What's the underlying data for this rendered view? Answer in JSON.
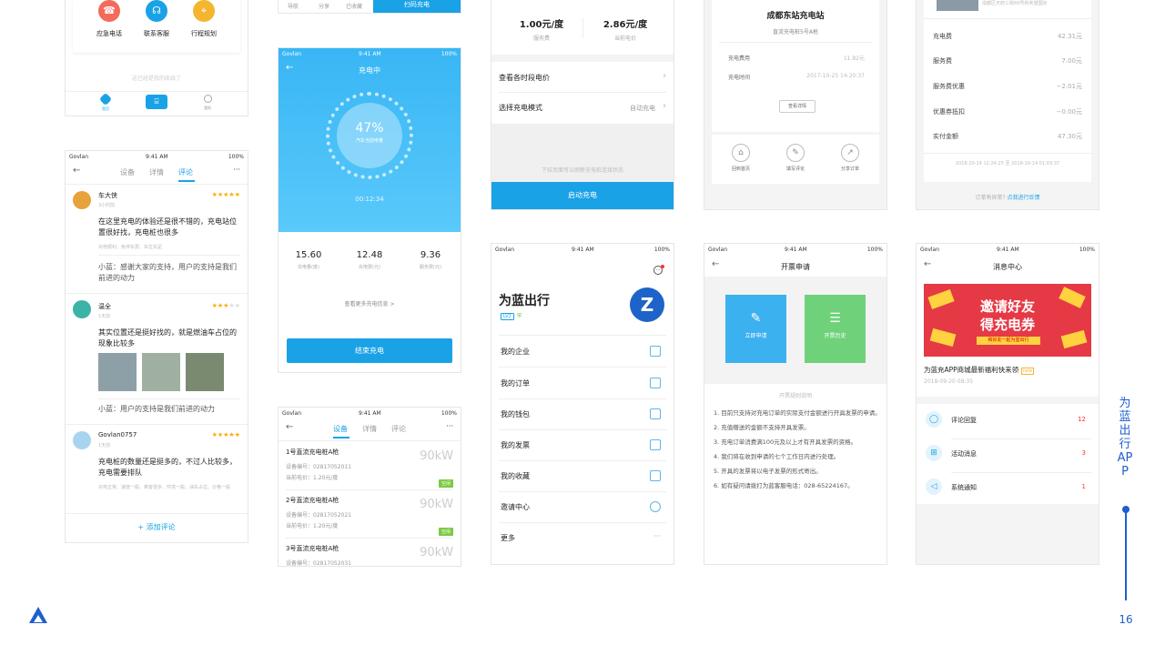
{
  "s1": {
    "actions": [
      {
        "label": "应急电话",
        "color": "#f26b5b"
      },
      {
        "label": "联系客服",
        "color": "#1aa2e6"
      },
      {
        "label": "行程规划",
        "color": "#f5b52e"
      }
    ],
    "bottom_note": "这已经是我的底线了",
    "tabbar": [
      {
        "label": "首页"
      },
      {
        "label": ""
      },
      {
        "label": "我的"
      }
    ]
  },
  "s2": {
    "tabs": [
      "导航",
      "分享",
      "已收藏"
    ],
    "button": "扫码充电"
  },
  "s3": {
    "prices": [
      {
        "value": "1.00元/度",
        "label": "服务费"
      },
      {
        "value": "2.86元/度",
        "label": "当前电价"
      }
    ],
    "rows": [
      {
        "label": "查看各时段电价",
        "value": ""
      },
      {
        "label": "选择充电模式",
        "value": "自动充电"
      }
    ],
    "hint": "下拉页面可以刷新充电桩连接状态",
    "button": "启动充电"
  },
  "s4": {
    "station": "成都东站充电站",
    "pile": "直流充电桩5号A枪",
    "rows": [
      {
        "label": "充电费用",
        "value": "11.82元"
      },
      {
        "label": "充电时间",
        "value": "2017-10-25 14:20:37"
      }
    ],
    "detail_btn": "查看详情",
    "actions": [
      {
        "label": "回到首页"
      },
      {
        "label": "填写评论"
      },
      {
        "label": "分享订单"
      }
    ]
  },
  "s5": {
    "addr": "成都区天府三街69号新希望国际",
    "rows": [
      {
        "label": "充电费",
        "value": "42.31元"
      },
      {
        "label": "服务费",
        "value": "7.00元"
      },
      {
        "label": "服务费优惠",
        "value": "−2.01元"
      },
      {
        "label": "优惠券抵扣",
        "value": "−0.00元"
      },
      {
        "label": "实付金额",
        "value": "47.30元"
      }
    ],
    "times": "2018-10-14 12:24:25   至 2018-10-14 01:03:37",
    "footer_q": "订单有异常?",
    "footer_link": "点我进行反馈"
  },
  "status": {
    "carrier": "Govlan",
    "time": "9:41 AM",
    "battery": "100%"
  },
  "reviews": {
    "tabs": [
      "设备",
      "详情",
      "评论"
    ],
    "more": "···",
    "items": [
      {
        "name": "车大侠",
        "time": "3小时前",
        "stars": 5,
        "text": "在这里充电的体验还是很不错的，充电站位置很好找，充电桩也很多",
        "tags": "充电顺利、免停车费、车位充足",
        "reply": "小蓝：感谢大家的支持，用户的支持是我们前进的动力",
        "photos": 0
      },
      {
        "name": "温全",
        "time": "1天前",
        "stars": 3,
        "text": "其实位置还是挺好找的，就是燃油车占位的现象比较多",
        "tags": "",
        "reply": "小蓝：用户的支持是我们前进的动力",
        "photos": 3
      },
      {
        "name": "Govlan0757",
        "time": "1天前",
        "stars": 5,
        "text": "充电桩的数量还是挺多的，不过人比较多，充电需要排队",
        "tags": "充电正常、速度一般、乘客很多、环境一般、油车占位、价格一般",
        "reply": "",
        "photos": 0
      }
    ],
    "add": "+ 添加评论"
  },
  "charging": {
    "title": "充电中",
    "percent": "47%",
    "sub": "汽车当前电量",
    "timer": "00:12:34",
    "stats": [
      {
        "value": "15.60",
        "label": "充电量(度)"
      },
      {
        "value": "12.48",
        "label": "充电费(元)"
      },
      {
        "value": "9.36",
        "label": "服务费(元)"
      }
    ],
    "more": "查看更多充电信息 >",
    "button": "结束充电"
  },
  "devices": {
    "tabs": [
      "设备",
      "详情",
      "评论"
    ],
    "more": "···",
    "items": [
      {
        "name": "1号直流充电桩A枪",
        "code": "设备编号：02817052011",
        "price": "当前电价：1.20元/度",
        "power": "90kW",
        "state": "空闲"
      },
      {
        "name": "2号直流充电桩A枪",
        "code": "设备编号：02817052021",
        "price": "当前电价：1.20元/度",
        "power": "90kW",
        "state": "空闲"
      },
      {
        "name": "3号直流充电桩A枪",
        "code": "设备编号：02817052031",
        "price": "",
        "power": "90kW",
        "state": ""
      }
    ]
  },
  "mine": {
    "title": "为蓝出行",
    "level": "LV2",
    "menu": [
      {
        "label": "我的企业"
      },
      {
        "label": "我的订单"
      },
      {
        "label": "我的钱包"
      },
      {
        "label": "我的发票"
      },
      {
        "label": "我的收藏"
      },
      {
        "label": "邀请中心"
      },
      {
        "label": "更多"
      }
    ]
  },
  "invoice": {
    "title": "开票申请",
    "btn1": "立即申请",
    "btn2": "开票历史",
    "rules_title": "开票规则说明",
    "rules": [
      "1. 目前只支持对充电订单的实际支付金额进行开具发票的申请。",
      "2. 充值赠送的金额不支持开具发票。",
      "3. 充电订单消费满100元及以上才有开具发票的资格。",
      "4. 我们将在收到申请的七个工作日内进行处理。",
      "5. 开具的发票将以电子发票的形式寄出。",
      "6. 如有疑问请拨打为蓝客服电话：028-65224167。"
    ]
  },
  "messages": {
    "title": "消息中心",
    "banner_line1": "邀请好友",
    "banner_line2": "得充电券",
    "banner_sub": "和好友一起为蓝出行",
    "headline": "为蓝充APP商城最新福利快来领",
    "badge": "new",
    "date": "2018-09-20 08:35",
    "items": [
      {
        "label": "评论回复",
        "count": "12"
      },
      {
        "label": "活动消息",
        "count": "3"
      },
      {
        "label": "系统通知",
        "count": "1"
      }
    ]
  },
  "side": {
    "title": "为蓝出行APP",
    "page": "16"
  }
}
